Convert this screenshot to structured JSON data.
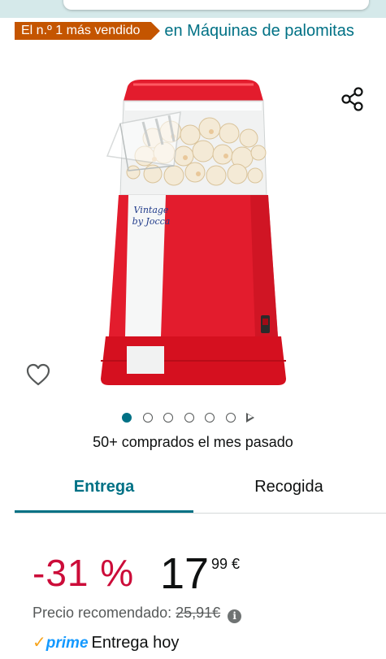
{
  "header": {
    "badge": "El n.º 1 más vendido",
    "category_text": "en Máquinas de palomitas"
  },
  "product": {
    "image_alt": "Palomitero rojo Vintage by Jocca",
    "brand_on_image": "Vintage by Jocca",
    "carousel": {
      "total": 6,
      "active_index": 1
    },
    "bought_text": "50+ comprados el mes pasado"
  },
  "tabs": [
    {
      "label": "Entrega",
      "selected": true
    },
    {
      "label": "Recogida",
      "selected": false
    }
  ],
  "pricing": {
    "discount": "-31 %",
    "price_whole": "17",
    "price_fraction": "99 €",
    "list_price_label": "Precio recomendado:",
    "list_price_value": "25,91€",
    "info_icon": "i"
  },
  "delivery": {
    "prime_check": "✓",
    "prime_label": "prime",
    "text": "Entrega hoy"
  },
  "colors": {
    "accent": "#007185",
    "badge": "#c45500",
    "discount": "#cc0c39",
    "prime": "#1399ff",
    "machine_red": "#e31c2d"
  }
}
